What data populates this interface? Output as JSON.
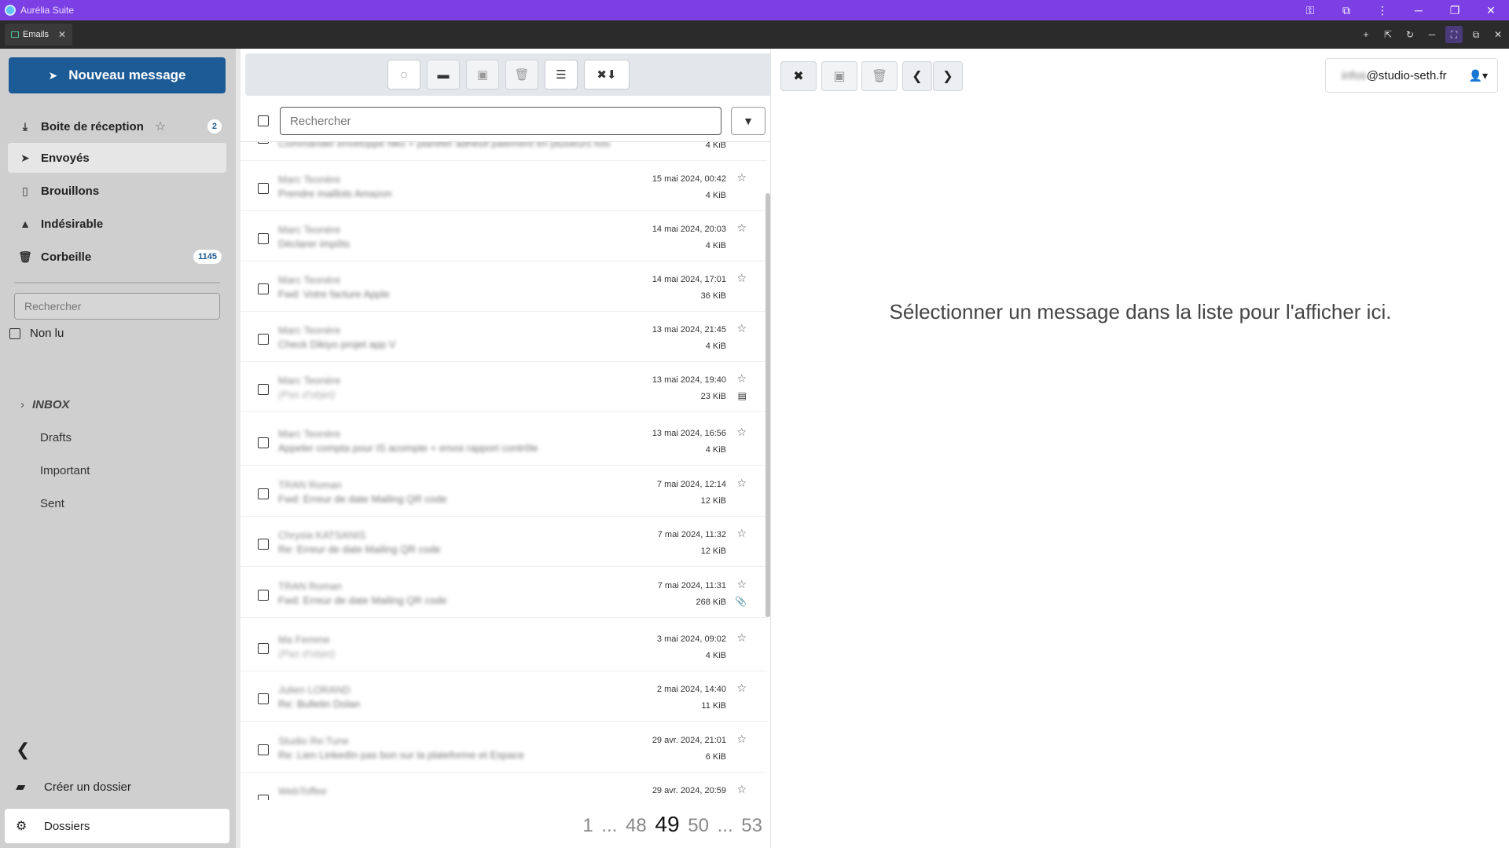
{
  "window": {
    "title": "Aurélia Suite"
  },
  "tabs": [
    {
      "label": "Emails",
      "close": "✕"
    }
  ],
  "sidebar": {
    "new_message": "Nouveau message",
    "folders": [
      {
        "label": "Boite de réception",
        "badge": "2"
      },
      {
        "label": "Envoyés"
      },
      {
        "label": "Brouillons"
      },
      {
        "label": "Indésirable"
      },
      {
        "label": "Corbeille",
        "badge": "1145"
      }
    ],
    "search_placeholder": "Rechercher",
    "unread_label": "Non lu",
    "tree": [
      "INBOX",
      "Drafts",
      "Important",
      "Sent"
    ],
    "create_folder": "Créer un dossier",
    "folders_settings": "Dossiers"
  },
  "list": {
    "search_placeholder": "Rechercher",
    "messages": [
      {
        "from": "",
        "subject": "Commander enveloppe Nko + planifier adhésif paiement en plusieurs fois",
        "date": "",
        "size": "4 KiB"
      },
      {
        "from": "Marc Teonère",
        "subject": "Prendre maillots Amazon",
        "date": "15 mai 2024, 00:42",
        "size": "4 KiB"
      },
      {
        "from": "Marc Teonère",
        "subject": "Déclarer impôts",
        "date": "14 mai 2024, 20:03",
        "size": "4 KiB"
      },
      {
        "from": "Marc Teonère",
        "subject": "Fwd: Votre facture Apple",
        "date": "14 mai 2024, 17:01",
        "size": "36 KiB"
      },
      {
        "from": "Marc Teonère",
        "subject": "Check Dikiyo projet app V",
        "date": "13 mai 2024, 21:45",
        "size": "4 KiB"
      },
      {
        "from": "Marc Teonère",
        "subject": "(Pas d'objet)",
        "date": "13 mai 2024, 19:40",
        "size": "23 KiB",
        "attachment": "doc"
      },
      {
        "from": "Marc Teonère",
        "subject": "Appeler compta pour IS acompte + envoi rapport contrôle",
        "date": "13 mai 2024, 16:56",
        "size": "4 KiB"
      },
      {
        "from": "TRAN Roman",
        "subject": "Fwd: Erreur de date Mailing QR code",
        "date": "7 mai 2024, 12:14",
        "size": "12 KiB"
      },
      {
        "from": "Chrysia KATSANIS",
        "subject": "Re: Erreur de date Mailing QR code",
        "date": "7 mai 2024, 11:32",
        "size": "12 KiB"
      },
      {
        "from": "TRAN Roman",
        "subject": "Fwd: Erreur de date Mailing QR code",
        "date": "7 mai 2024, 11:31",
        "size": "268 KiB",
        "attachment": "clip"
      },
      {
        "from": "Ma Femme",
        "subject": "(Pas d'objet)",
        "date": "3 mai 2024, 09:02",
        "size": "4 KiB"
      },
      {
        "from": "Julien LORAND",
        "subject": "Re: Bulletin Dolan",
        "date": "2 mai 2024, 14:40",
        "size": "11 KiB"
      },
      {
        "from": "Studio Re:Tune",
        "subject": "Re: Lien LinkedIn pas bon sur la plateforme et Espace",
        "date": "29 avr. 2024, 21:01",
        "size": "6 KiB"
      },
      {
        "from": "WebToffee",
        "subject": "",
        "date": "29 avr. 2024, 20:59",
        "size": ""
      }
    ],
    "pager": {
      "first": "1",
      "ellipsis1": "...",
      "prev": "48",
      "current": "49",
      "next": "50",
      "ellipsis2": "...",
      "last": "53"
    }
  },
  "pane": {
    "account_email_blur": "infos",
    "account_email": "@studio-seth.fr",
    "empty_text": "Sélectionner un message dans la liste pour l'afficher ici."
  },
  "colors": {
    "titlebar": "#7b3fe4",
    "accent": "#1d5b96",
    "sidebar": "#cfcfcf"
  },
  "icons": [
    "paper-plane-icon",
    "inbox-download-icon",
    "star-icon",
    "file-icon",
    "warning-icon",
    "trash-icon",
    "folder-plus-icon",
    "gear-icon",
    "chevron-left-icon",
    "refresh-icon",
    "folder-icon",
    "archive-icon",
    "menu-icon",
    "close-icon",
    "user-icon",
    "paperclip-icon"
  ]
}
